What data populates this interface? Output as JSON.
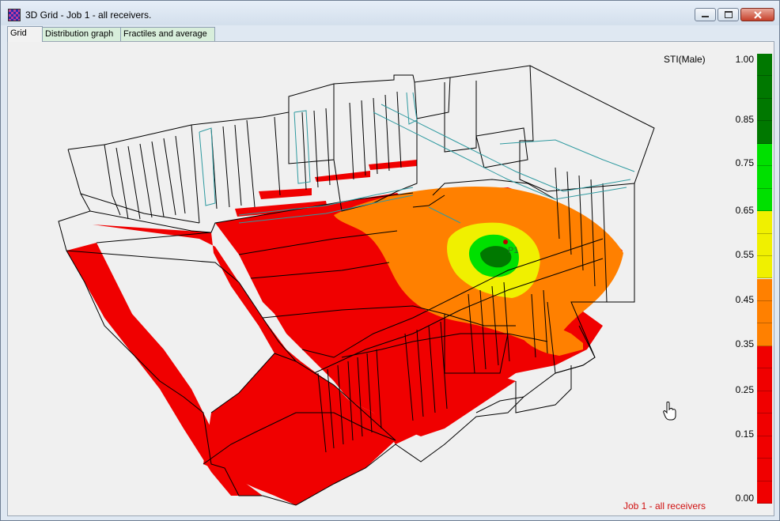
{
  "window": {
    "title": "3D Grid - Job 1 - all receivers."
  },
  "tabs": [
    {
      "label": "Grid",
      "active": true
    },
    {
      "label": "Distribution graph",
      "active": false
    },
    {
      "label": "Fractiles and average",
      "active": false
    }
  ],
  "icons": {
    "app": "app-icon",
    "minimize": "minimize-icon",
    "maximize": "maximize-icon",
    "close": "close-icon",
    "cursor": "hand-cursor-icon"
  },
  "legend": {
    "title": "STI(Male)",
    "ticks": [
      "1.00",
      "0.85",
      "0.75",
      "0.65",
      "0.55",
      "0.45",
      "0.35",
      "0.25",
      "0.15",
      "0.00"
    ],
    "color_steps": [
      "#007800",
      "#007800",
      "#007800",
      "#007800",
      "#00e000",
      "#00e000",
      "#00e000",
      "#f0f000",
      "#f0f000",
      "#f0f000",
      "#ff8000",
      "#ff8000",
      "#ff8000",
      "#f00000",
      "#f00000",
      "#f00000",
      "#f00000",
      "#f00000",
      "#f00000",
      "#f00000"
    ]
  },
  "receiver": {
    "label": "P1"
  },
  "footer": {
    "job_label": "Job 1 - all receivers"
  },
  "colors": {
    "red": "#f00000",
    "orange": "#ff8000",
    "yellow": "#f0f000",
    "green": "#00e000",
    "dark_green": "#007800",
    "teal": "#2f9aa0",
    "job_text": "#d01010"
  }
}
